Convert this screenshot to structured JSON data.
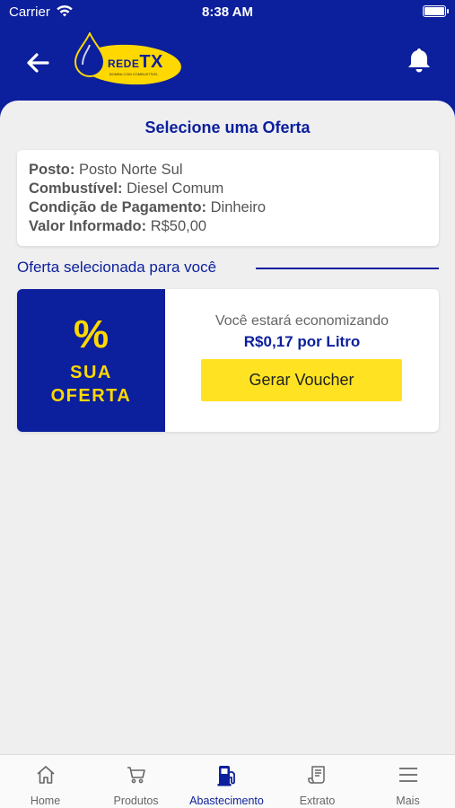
{
  "status": {
    "carrier": "Carrier",
    "time": "8:38 AM"
  },
  "header": {
    "logo_text_a": "REDE",
    "logo_text_b": "TX",
    "logo_subtitle": "BOMBA COM COMBUSTÍVEL",
    "back_icon": "arrow-left-icon",
    "bell_icon": "bell-icon"
  },
  "page": {
    "title": "Selecione uma Oferta"
  },
  "info": {
    "posto_label": "Posto:",
    "posto_value": "Posto Norte Sul",
    "combustivel_label": "Combustível:",
    "combustivel_value": "Diesel Comum",
    "pagamento_label": "Condição de Pagamento:",
    "pagamento_value": "Dinheiro",
    "valor_label": "Valor Informado:",
    "valor_value": "R$50,00"
  },
  "section": {
    "label": "Oferta selecionada para você"
  },
  "offer": {
    "badge_symbol": "%",
    "badge_line1": "SUA",
    "badge_line2": "OFERTA",
    "saving_text": "Você estará economizando",
    "amount": "R$0,17 por Litro",
    "button_label": "Gerar Voucher"
  },
  "tabs": [
    {
      "label": "Home",
      "icon": "home-icon"
    },
    {
      "label": "Produtos",
      "icon": "cart-icon"
    },
    {
      "label": "Abastecimento",
      "icon": "fuel-pump-icon",
      "active": true
    },
    {
      "label": "Extrato",
      "icon": "receipt-icon"
    },
    {
      "label": "Mais",
      "icon": "menu-icon"
    }
  ],
  "colors": {
    "primary": "#0c1f9c",
    "accent": "#ffe322",
    "background": "#efeff0"
  }
}
